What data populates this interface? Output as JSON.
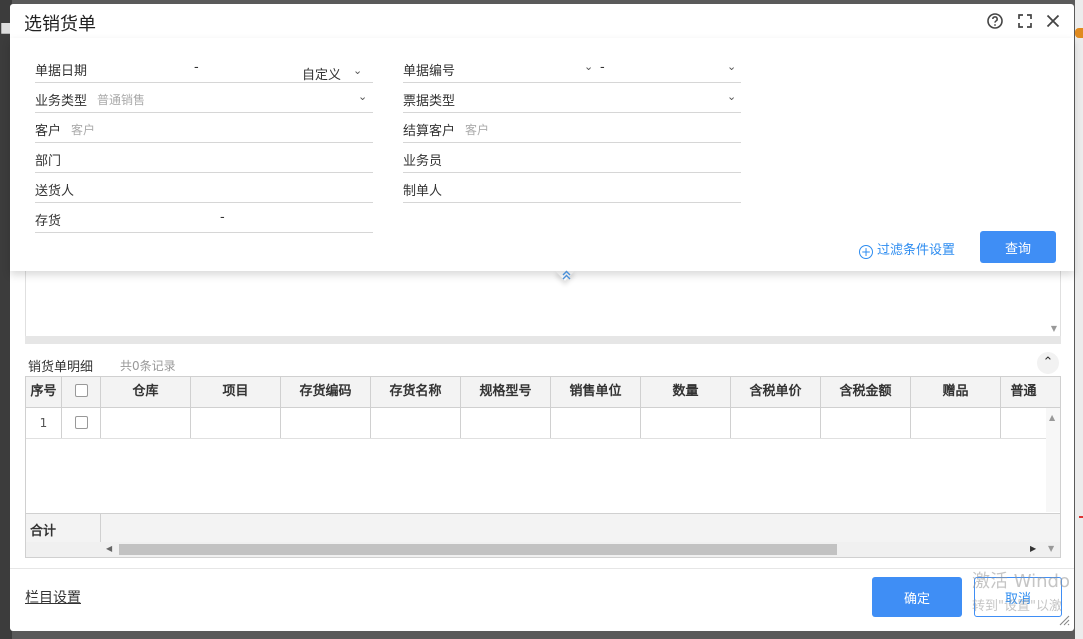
{
  "dialog": {
    "title": "选销货单"
  },
  "filter": {
    "row1_left_label": "单据日期",
    "date_separator": "-",
    "date_mode": "自定义",
    "row1_right_label": "单据编号",
    "number_separator": "-",
    "row2_left_label": "业务类型",
    "business_type_value": "普通销售",
    "row2_right_label": "票据类型",
    "row3_left_label": "客户",
    "customer_placeholder": "客户",
    "row3_right_label": "结算客户",
    "settle_customer_placeholder": "客户",
    "row4_left_label": "部门",
    "row4_right_label": "业务员",
    "row5_left_label": "送货人",
    "row5_right_label": "制单人",
    "row6_left_label": "存货",
    "inventory_separator": "-",
    "settings_link": "过滤条件设置",
    "query_button": "查询"
  },
  "detail": {
    "title": "销货单明细",
    "count": "共0条记录",
    "columns": [
      "序号",
      "",
      "仓库",
      "项目",
      "存货编码",
      "存货名称",
      "规格型号",
      "销售单位",
      "数量",
      "含税单价",
      "含税金额",
      "赠品",
      "普通"
    ],
    "rows": [
      {
        "index": "1"
      }
    ],
    "total_label": "合计"
  },
  "footer": {
    "column_settings": "栏目设置",
    "ok_button": "确定",
    "cancel_button": "取消"
  },
  "watermark": {
    "line1": "激活 Windo",
    "line2": "转到\"设置\"以激"
  },
  "colors": {
    "primary": "#3f8ef5",
    "link": "#2d8cf0"
  }
}
